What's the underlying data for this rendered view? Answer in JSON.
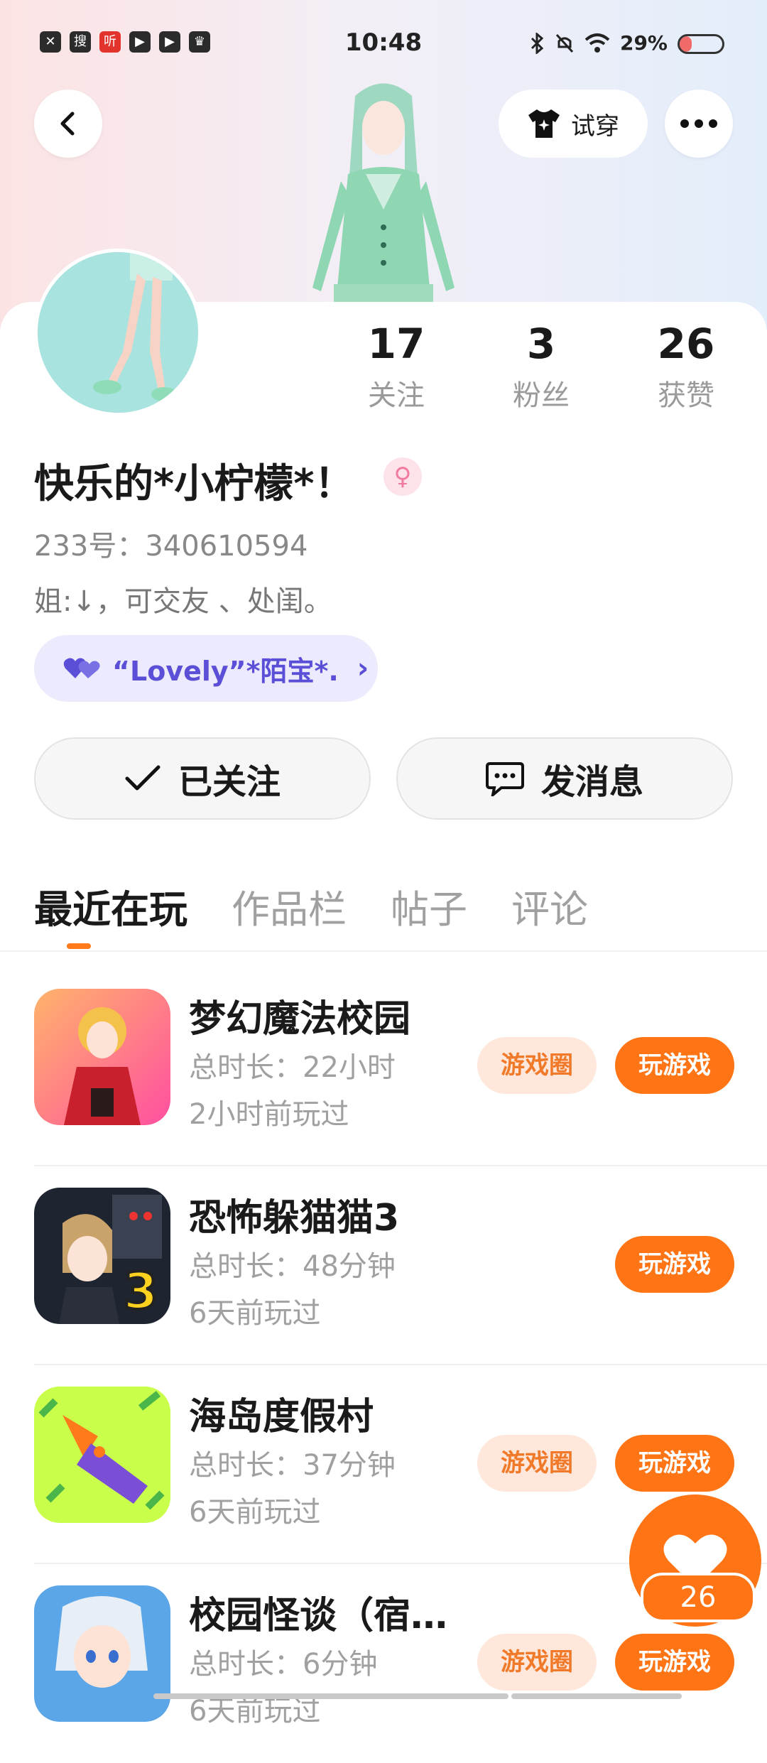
{
  "status_bar": {
    "time": "10:48",
    "battery": "29%",
    "battery_level": 0.29,
    "left_icons": [
      "close-icon",
      "search-app-icon",
      "listen-app-icon",
      "play-icon",
      "play-icon",
      "crown-icon"
    ],
    "left_glyphs": [
      "✕",
      "搜",
      "听",
      "▶",
      "▶",
      "♛"
    ]
  },
  "header": {
    "back_icon": "chevron-left-icon",
    "tryon_label": "试穿",
    "more_icon": "more-dots-icon"
  },
  "profile": {
    "stats": [
      {
        "value": "17",
        "label": "关注"
      },
      {
        "value": "3",
        "label": "粉丝"
      },
      {
        "value": "26",
        "label": "获赞"
      }
    ],
    "username": "快乐的*小柠檬*！",
    "gender_symbol": "♀",
    "id_line": "233号：340610594",
    "bio": "姐:↓，可交友 、处闺。",
    "group_name": "“Lovely”*陌宝*.",
    "group_chevron": "›"
  },
  "actions": {
    "follow_label": "已关注",
    "message_label": "发消息"
  },
  "tabs": [
    {
      "label": "最近在玩",
      "active": true
    },
    {
      "label": "作品栏",
      "active": false
    },
    {
      "label": "帖子",
      "active": false
    },
    {
      "label": "评论",
      "active": false
    }
  ],
  "games": [
    {
      "name": "梦幻魔法校园",
      "duration": "总时长：22小时",
      "last_played": "2小时前玩过",
      "circle_label": "游戏圈",
      "play_label": "玩游戏"
    },
    {
      "name": "恐怖躲猫猫3",
      "duration": "总时长：48分钟",
      "last_played": "6天前玩过",
      "circle_label": "",
      "play_label": "玩游戏"
    },
    {
      "name": "海岛度假村",
      "duration": "总时长：37分钟",
      "last_played": "6天前玩过",
      "circle_label": "游戏圈",
      "play_label": "玩游戏"
    },
    {
      "name": "校园怪谈（宿…",
      "duration": "总时长：6分钟",
      "last_played": "6天前玩过",
      "circle_label": "游戏圈",
      "play_label": "玩游戏"
    }
  ],
  "like_fab": {
    "count": "26"
  },
  "colors": {
    "accent": "#ff7414",
    "group_chip": "#ecebfd",
    "group_text": "#5a4fd6"
  }
}
